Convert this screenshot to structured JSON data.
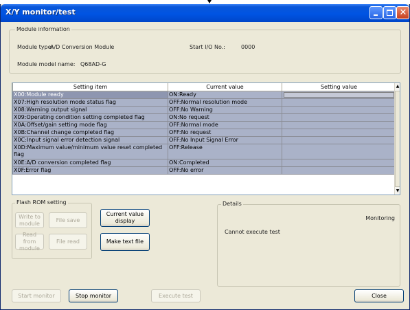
{
  "window": {
    "title": "X/Y monitor/test"
  },
  "module_info": {
    "legend": "Module information",
    "type_label": "Module type:",
    "type_value": "A/D Conversion Module",
    "start_io_label": "Start I/O No.:",
    "start_io_value": "0000",
    "model_label": "Module model name:",
    "model_value": "Q68AD-G"
  },
  "table": {
    "columns": [
      "Setting item",
      "Current value",
      "Setting value"
    ],
    "rows": [
      {
        "item": "X00:Module ready",
        "current": "ON:Ready",
        "setting": ""
      },
      {
        "item": "X07:High resolution mode status flag",
        "current": "OFF:Normal resolution mode",
        "setting": ""
      },
      {
        "item": "X08:Warning output signal",
        "current": "OFF:No Warning",
        "setting": ""
      },
      {
        "item": "X09:Operating condition setting completed flag",
        "current": "ON:No request",
        "setting": ""
      },
      {
        "item": "X0A:Offset/gain setting mode flag",
        "current": "OFF:Normal mode",
        "setting": ""
      },
      {
        "item": "X0B:Channel change completed flag",
        "current": "OFF:No request",
        "setting": ""
      },
      {
        "item": "X0C:Input signal error detection signal",
        "current": "OFF:No Input Signal Error",
        "setting": ""
      },
      {
        "item": "X0D:Maximum value/minimum value reset completed flag",
        "current": "OFF:Release",
        "setting": ""
      },
      {
        "item": "X0E:A/D conversion completed flag",
        "current": "ON:Completed",
        "setting": ""
      },
      {
        "item": "X0F:Error flag",
        "current": "OFF:No error",
        "setting": ""
      }
    ]
  },
  "flash_rom": {
    "legend": "Flash ROM setting",
    "write_to_module": "Write to module",
    "file_save": "File save",
    "read_from_module": "Read from module",
    "file_read": "File read"
  },
  "buttons": {
    "current_value_display": "Current value display",
    "make_text_file": "Make text file",
    "start_monitor": "Start monitor",
    "stop_monitor": "Stop monitor",
    "execute_test": "Execute test",
    "close": "Close"
  },
  "details": {
    "legend": "Details",
    "status": "Monitoring",
    "message": "Cannot execute test"
  }
}
